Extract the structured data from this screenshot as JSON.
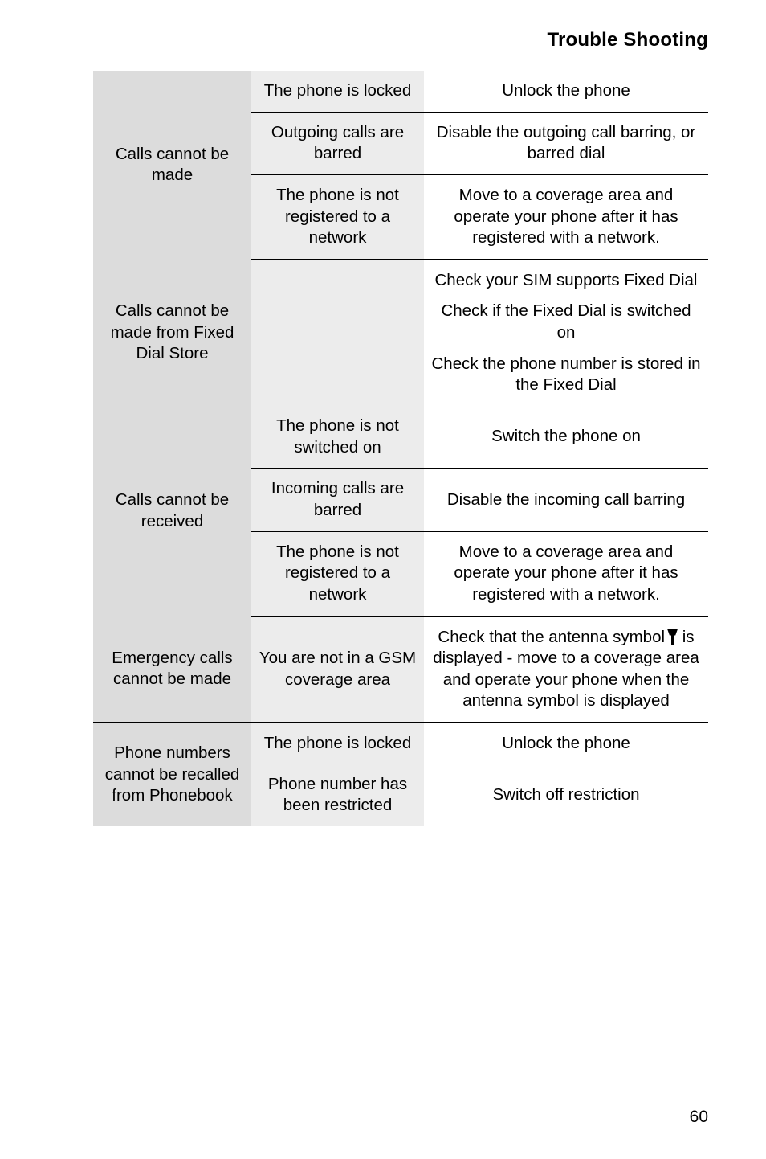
{
  "header": {
    "title": "Trouble Shooting"
  },
  "footer": {
    "page_number": "60"
  },
  "table": {
    "groups": [
      {
        "problem": "Calls cannot be made",
        "rows": [
          {
            "cause": "The phone is locked",
            "remedy": "Unlock the phone"
          },
          {
            "cause": "Outgoing calls are barred",
            "remedy": "Disable the outgoing call barring, or barred dial"
          },
          {
            "cause": "The phone is not registered to a network",
            "remedy": "Move to a coverage area and operate your phone after it has registered with a network."
          }
        ]
      },
      {
        "problem": "Calls cannot be made from Fixed Dial Store",
        "rows": [
          {
            "cause": "",
            "remedy_paragraphs": [
              "Check your SIM supports Fixed Dial",
              "Check if the Fixed Dial is switched on",
              "Check the phone number is stored in the Fixed Dial"
            ]
          }
        ]
      },
      {
        "problem": "Calls cannot be received",
        "rows": [
          {
            "cause": "The phone is not switched on",
            "remedy": "Switch the phone on"
          },
          {
            "cause": "Incoming calls are barred",
            "remedy": "Disable the incoming call barring"
          },
          {
            "cause": "The phone is not registered to a network",
            "remedy": "Move to a coverage area and operate your phone after it has registered with a network."
          }
        ]
      },
      {
        "problem": "Emergency calls cannot be made",
        "rows": [
          {
            "cause": "You are not in a GSM coverage area",
            "remedy_before_icon": "Check that the antenna symbol",
            "remedy_icon": "antenna-icon",
            "remedy_after_icon": "is displayed - move to a coverage area and operate your phone when the antenna symbol is displayed"
          }
        ]
      },
      {
        "problem": "Phone numbers cannot be recalled from Phonebook",
        "rows": [
          {
            "cause": "The phone is locked",
            "remedy": "Unlock the phone"
          },
          {
            "cause": "Phone number has been restricted",
            "remedy": "Switch off restriction"
          }
        ]
      }
    ]
  },
  "colors": {
    "problem_column_bg": "#dcdcdc",
    "cause_column_bg": "#ececec",
    "remedy_column_bg": "#ffffff",
    "rule": "#000000",
    "text": "#000000"
  }
}
